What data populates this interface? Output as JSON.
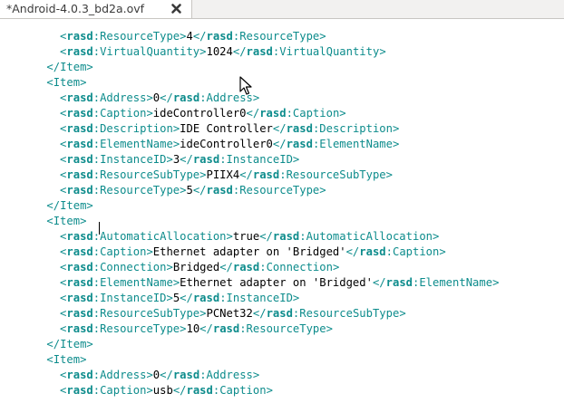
{
  "tab": {
    "title": "*Android-4.0.3_bd2a.ovf",
    "close_icon": "close-icon"
  },
  "colors": {
    "tag": "#0d8c8c",
    "text": "#000000"
  },
  "lines": [
    {
      "indent": 4,
      "kind": "elem",
      "tag": "rasd:ResourceType",
      "value": "4"
    },
    {
      "indent": 4,
      "kind": "elem",
      "tag": "rasd:VirtualQuantity",
      "value": "1024"
    },
    {
      "indent": 3,
      "kind": "close",
      "tag": "Item"
    },
    {
      "indent": 3,
      "kind": "open",
      "tag": "Item"
    },
    {
      "indent": 4,
      "kind": "elem",
      "tag": "rasd:Address",
      "value": "0"
    },
    {
      "indent": 4,
      "kind": "elem",
      "tag": "rasd:Caption",
      "value": "ideController0"
    },
    {
      "indent": 4,
      "kind": "elem",
      "tag": "rasd:Description",
      "value": "IDE Controller"
    },
    {
      "indent": 4,
      "kind": "elem",
      "tag": "rasd:ElementName",
      "value": "ideController0"
    },
    {
      "indent": 4,
      "kind": "elem",
      "tag": "rasd:InstanceID",
      "value": "3"
    },
    {
      "indent": 4,
      "kind": "elem",
      "tag": "rasd:ResourceSubType",
      "value": "PIIX4"
    },
    {
      "indent": 4,
      "kind": "elem",
      "tag": "rasd:ResourceType",
      "value": "5"
    },
    {
      "indent": 3,
      "kind": "close",
      "tag": "Item"
    },
    {
      "indent": 3,
      "kind": "open",
      "tag": "Item"
    },
    {
      "indent": 4,
      "kind": "elem",
      "tag": "rasd:AutomaticAllocation",
      "value": "true"
    },
    {
      "indent": 4,
      "kind": "elem",
      "tag": "rasd:Caption",
      "value": "Ethernet adapter on 'Bridged'"
    },
    {
      "indent": 4,
      "kind": "elem",
      "tag": "rasd:Connection",
      "value": "Bridged"
    },
    {
      "indent": 4,
      "kind": "elem",
      "tag": "rasd:ElementName",
      "value": "Ethernet adapter on 'Bridged'"
    },
    {
      "indent": 4,
      "kind": "elem",
      "tag": "rasd:InstanceID",
      "value": "5"
    },
    {
      "indent": 4,
      "kind": "elem",
      "tag": "rasd:ResourceSubType",
      "value": "PCNet32"
    },
    {
      "indent": 4,
      "kind": "elem",
      "tag": "rasd:ResourceType",
      "value": "10"
    },
    {
      "indent": 3,
      "kind": "close",
      "tag": "Item"
    },
    {
      "indent": 3,
      "kind": "open",
      "tag": "Item"
    },
    {
      "indent": 4,
      "kind": "elem",
      "tag": "rasd:Address",
      "value": "0"
    },
    {
      "indent": 4,
      "kind": "elem",
      "tag": "rasd:Caption",
      "value": "usb"
    }
  ]
}
